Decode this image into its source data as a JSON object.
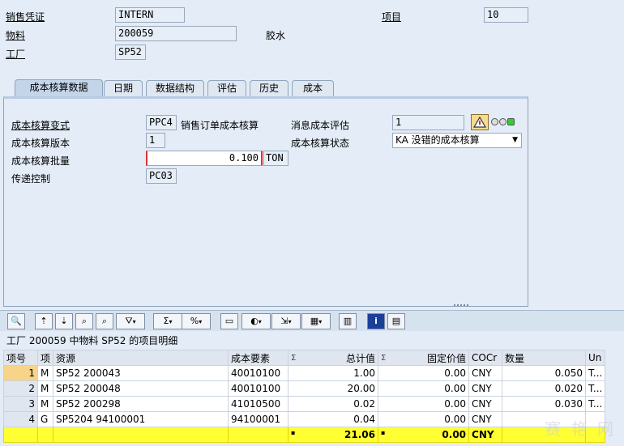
{
  "header": {
    "sales_doc_label": "销售凭证",
    "sales_doc_value": "INTERN",
    "item_label": "项目",
    "item_value": "10",
    "material_label": "物料",
    "material_value": "200059",
    "material_desc": "胶水",
    "plant_label": "工厂",
    "plant_value": "SP52"
  },
  "tabs": [
    "成本核算数据",
    "日期",
    "数据结构",
    "评估",
    "历史",
    "成本"
  ],
  "costing": {
    "variant_label": "成本核算变式",
    "variant_value": "PPC4",
    "variant_desc": "销售订单成本核算",
    "version_label": "成本核算版本",
    "version_value": "1",
    "lot_label": "成本核算批量",
    "lot_value": "0.100",
    "lot_unit": "TON",
    "transfer_label": "传递控制",
    "transfer_value": "PC03",
    "msg_label": "消息成本评估",
    "msg_value": "1",
    "status_label": "成本核算状态",
    "status_value": "KA 没错的成本核算"
  },
  "toolbar_dropdown_glyph": "▾",
  "grid": {
    "title": "工厂 200059 中物料 SP52 的项目明细",
    "columns": [
      "项号",
      "项",
      "资源",
      "成本要素",
      "总计值",
      "固定价值",
      "COCr",
      "数量",
      "Un"
    ],
    "sigma": "Σ",
    "rows": [
      {
        "no": "1",
        "t": "M",
        "res": "SP52 200043",
        "ce": "40010100",
        "total": "1.00",
        "fixed": "0.00",
        "cur": "CNY",
        "qty": "0.050",
        "un": "T..."
      },
      {
        "no": "2",
        "t": "M",
        "res": "SP52 200048",
        "ce": "40010100",
        "total": "20.00",
        "fixed": "0.00",
        "cur": "CNY",
        "qty": "0.020",
        "un": "T..."
      },
      {
        "no": "3",
        "t": "M",
        "res": "SP52 200298",
        "ce": "41010500",
        "total": "0.02",
        "fixed": "0.00",
        "cur": "CNY",
        "qty": "0.030",
        "un": "T..."
      },
      {
        "no": "4",
        "t": "G",
        "res": "SP5204 94100001",
        "ce": "94100001",
        "total": "0.04",
        "fixed": "0.00",
        "cur": "CNY",
        "qty": "",
        "un": ""
      }
    ],
    "total_row": {
      "mark": "▪",
      "total": "21.06",
      "fixed": "0.00",
      "cur": "CNY"
    }
  },
  "watermark": "赛 艳 网"
}
